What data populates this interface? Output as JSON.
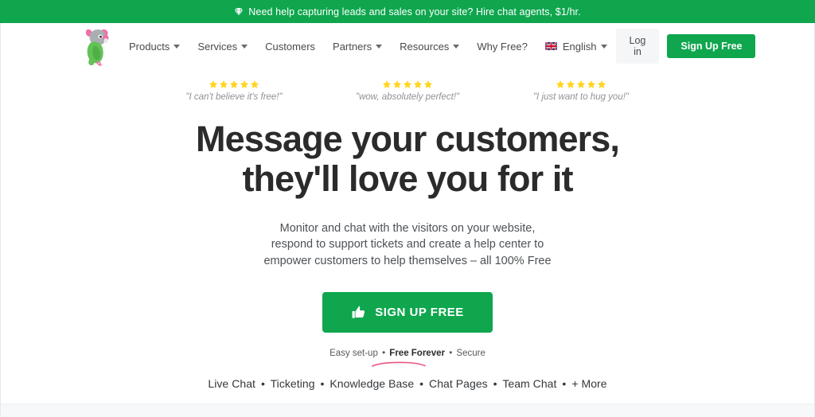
{
  "promo_banner": {
    "icon": "gem-icon",
    "text": "Need help capturing leads and sales on your site? Hire chat agents, $1/hr.",
    "background_color": "#0FA64E",
    "text_color": "#FFFFFF"
  },
  "header": {
    "logo": "parrot-logo",
    "nav_items": [
      {
        "label": "Products",
        "has_dropdown": true
      },
      {
        "label": "Services",
        "has_dropdown": true
      },
      {
        "label": "Customers",
        "has_dropdown": false
      },
      {
        "label": "Partners",
        "has_dropdown": true
      },
      {
        "label": "Resources",
        "has_dropdown": true
      },
      {
        "label": "Why Free?",
        "has_dropdown": false
      }
    ],
    "language": {
      "label": "English",
      "flag": "uk-flag-icon",
      "has_dropdown": true
    },
    "login_label": "Log in",
    "signup_label": "Sign Up Free"
  },
  "hero": {
    "testimonials": [
      {
        "stars": 5,
        "quote": "\"I can't believe it's free!\""
      },
      {
        "stars": 5,
        "quote": "\"wow, absolutely perfect!\""
      },
      {
        "stars": 5,
        "quote": "\"I just want to hug you!\""
      }
    ],
    "headline_line1": "Message your customers,",
    "headline_line2": "they'll love you for it",
    "subhead_line1": "Monitor and chat with the visitors on your website,",
    "subhead_line2": "respond to support tickets and create a help center to",
    "subhead_line3": "empower customers to help themselves – all 100% Free",
    "cta_label": "SIGN UP FREE",
    "cta_icon": "thumbs-up-icon",
    "assurance": {
      "easy": "Easy set-up",
      "free": "Free Forever",
      "secure": "Secure",
      "separator": "•",
      "underline_color": "#E8557F"
    },
    "features": [
      "Live Chat",
      "Ticketing",
      "Knowledge Base",
      "Chat Pages",
      "Team Chat",
      "+ More"
    ],
    "feature_separator": "•"
  },
  "colors": {
    "brand_green": "#0FA64E",
    "star_yellow": "#FFD520",
    "text_dark": "#2B2B2B",
    "text_muted": "#8E9296",
    "pink_accent": "#E8557F"
  }
}
